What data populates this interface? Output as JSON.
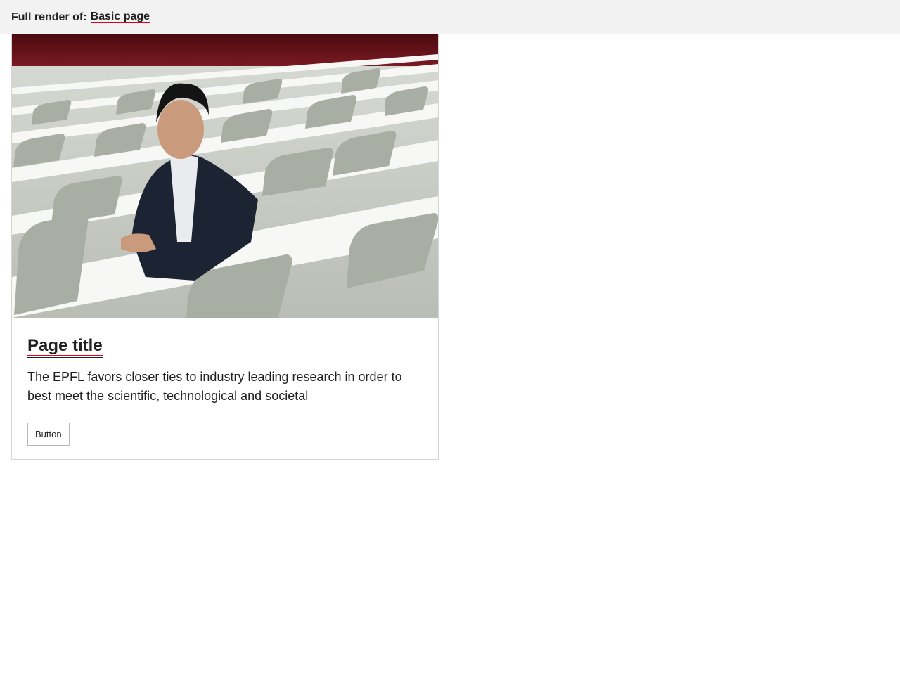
{
  "header": {
    "prefix": "Full render of:",
    "link_label": "Basic page"
  },
  "card": {
    "title": "Page title",
    "text": "The EPFL favors closer ties to industry leading research in order to best meet the scientific, technological and societal",
    "button_label": "Button"
  },
  "colors": {
    "accent": "#e2001a",
    "topbar_bg": "#f2f2f3",
    "text": "#212121",
    "border": "#d5d5d5"
  }
}
